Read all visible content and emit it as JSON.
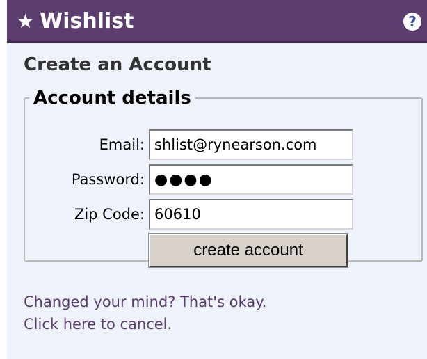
{
  "widget": {
    "title": "Wishlist",
    "title_icon": "★",
    "help_icon": "?"
  },
  "form": {
    "heading": "Create an Account",
    "legend": "Account details",
    "email_label": "Email:",
    "email_value": "shlist@rynearson.com",
    "password_label": "Password:",
    "password_value": "●●●●",
    "zip_label": "Zip Code:",
    "zip_value": "60610",
    "submit_label": "create account"
  },
  "cancel": {
    "line1": "Changed your mind? That's okay.",
    "line2": "Click here to cancel."
  },
  "colors": {
    "titlebar": "#5b3d6e",
    "panel_bg": "#eef3fb",
    "link_text": "#5b3d6e"
  }
}
